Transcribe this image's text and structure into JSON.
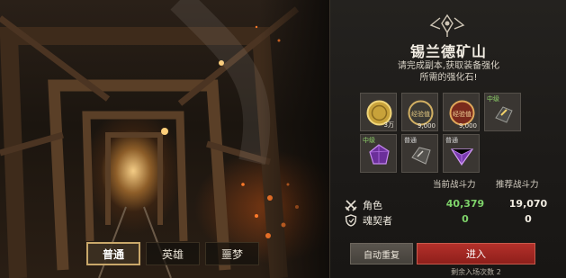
{
  "dungeon": {
    "title": "锡兰德矿山",
    "description_line1": "请完成副本,获取装备强化",
    "description_line2": "所需的强化石!"
  },
  "rewards": [
    {
      "icon": "gold-coin-icon",
      "grade": "",
      "count": "3万"
    },
    {
      "icon": "exp-coin-icon",
      "grade": "",
      "label": "经验值",
      "count": "9,000"
    },
    {
      "icon": "exp-coin-icon",
      "grade": "",
      "label": "经验值",
      "count": "9,000"
    },
    {
      "icon": "enhance-stone-icon",
      "grade": "中级",
      "count": ""
    },
    {
      "icon": "purple-crystal-icon",
      "grade": "中级",
      "count": ""
    },
    {
      "icon": "gray-stone-icon",
      "grade": "普通",
      "count": ""
    },
    {
      "icon": "purple-crystal-icon",
      "grade": "普通",
      "count": ""
    }
  ],
  "stats": {
    "header_current": "当前战斗力",
    "header_recommended": "推荐战斗力",
    "rows": [
      {
        "icon": "crossed-swords-icon",
        "label": "角色",
        "current": "40,379",
        "recommended": "19,070"
      },
      {
        "icon": "shield-icon",
        "label": "魂契者",
        "current": "0",
        "recommended": "0"
      }
    ]
  },
  "difficulty_tabs": [
    {
      "label": "普通",
      "active": true
    },
    {
      "label": "英雄",
      "active": false
    },
    {
      "label": "噩梦",
      "active": false
    }
  ],
  "buttons": {
    "auto_repeat": "自动重复",
    "enter": "进入",
    "remaining": "剩余入场次数 2"
  },
  "colors": {
    "accent_gold": "#c9a86a",
    "enter_red": "#a3271f",
    "power_green": "#7ed36a",
    "grade_green": "#8fd36b"
  }
}
